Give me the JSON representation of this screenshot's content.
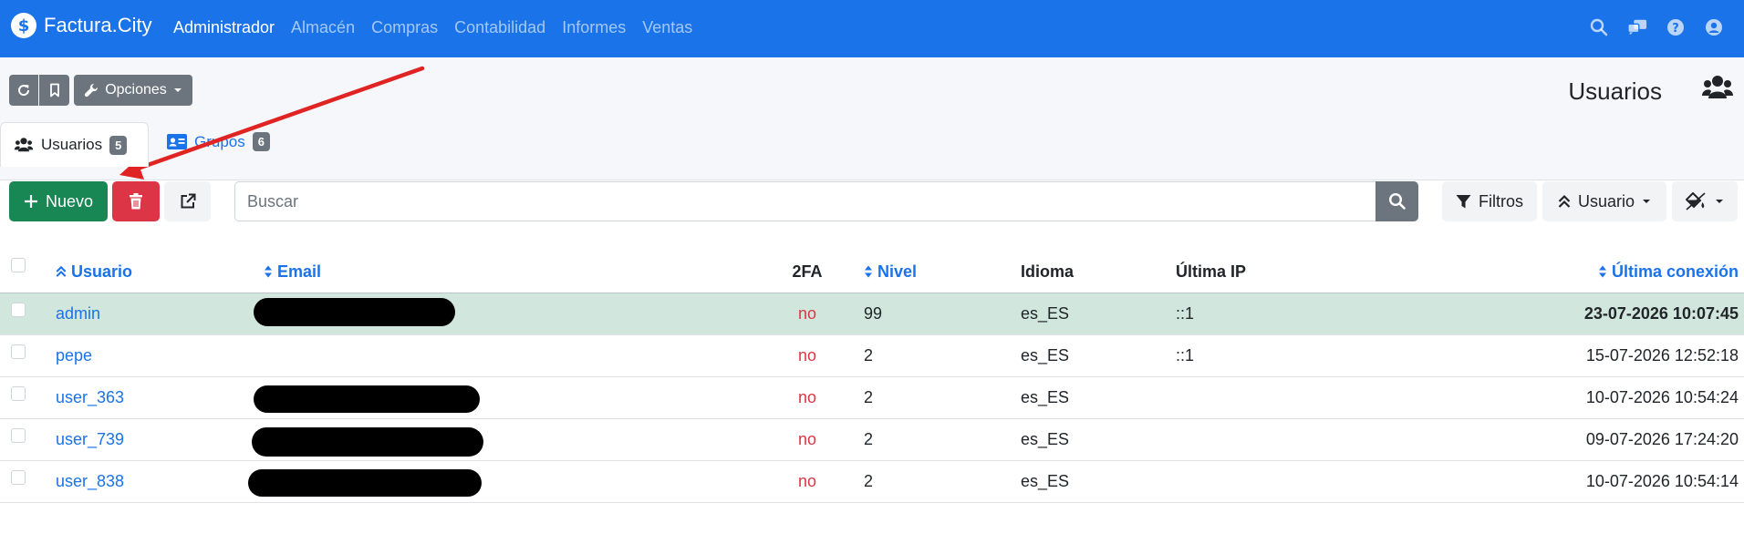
{
  "navbar": {
    "brand": "Factura.City",
    "menu": [
      "Administrador",
      "Almacén",
      "Compras",
      "Contabilidad",
      "Informes",
      "Ventas"
    ],
    "active": "Administrador",
    "icons": [
      "search-icon",
      "chat-icon",
      "help-icon",
      "user-icon"
    ]
  },
  "toolbar_top": {
    "options_label": "Opciones",
    "icons": [
      "refresh-icon",
      "bookmark-icon",
      "wrench-icon"
    ]
  },
  "page": {
    "title": "Usuarios",
    "title_icon": "users-icon"
  },
  "tabs": [
    {
      "label": "Usuarios",
      "count": "5",
      "active": true
    },
    {
      "label": "Grupos",
      "count": "6",
      "active": false
    }
  ],
  "toolbar": {
    "new_label": "Nuevo",
    "search_placeholder": "Buscar",
    "filters_label": "Filtros",
    "sort_label": "Usuario"
  },
  "table": {
    "headers": {
      "user": "Usuario",
      "email": "Email",
      "twofa": "2FA",
      "level": "Nivel",
      "language": "Idioma",
      "last_ip": "Última IP",
      "last_login": "Última conexión"
    },
    "rows": [
      {
        "user": "admin",
        "twofa": "no",
        "level": "99",
        "language": "es_ES",
        "last_ip": "::1",
        "last_login": "23-07-2026 10:07:45",
        "highlight": true,
        "email_redacted": true
      },
      {
        "user": "pepe",
        "twofa": "no",
        "level": "2",
        "language": "es_ES",
        "last_ip": "::1",
        "last_login": "15-07-2026 12:52:18",
        "highlight": false,
        "email_redacted": false
      },
      {
        "user": "user_363",
        "twofa": "no",
        "level": "2",
        "language": "es_ES",
        "last_ip": "",
        "last_login": "10-07-2026 10:54:24",
        "highlight": false,
        "email_redacted": true
      },
      {
        "user": "user_739",
        "twofa": "no",
        "level": "2",
        "language": "es_ES",
        "last_ip": "",
        "last_login": "09-07-2026 17:24:20",
        "highlight": false,
        "email_redacted": true
      },
      {
        "user": "user_838",
        "twofa": "no",
        "level": "2",
        "language": "es_ES",
        "last_ip": "",
        "last_login": "10-07-2026 10:54:14",
        "highlight": false,
        "email_redacted": true
      }
    ]
  },
  "colors": {
    "primary": "#1a73e8",
    "success": "#198754",
    "danger": "#dc3545",
    "secondary": "#6c757d",
    "row_highlight": "#d1e7dd",
    "annotation_arrow": "#e02424"
  }
}
